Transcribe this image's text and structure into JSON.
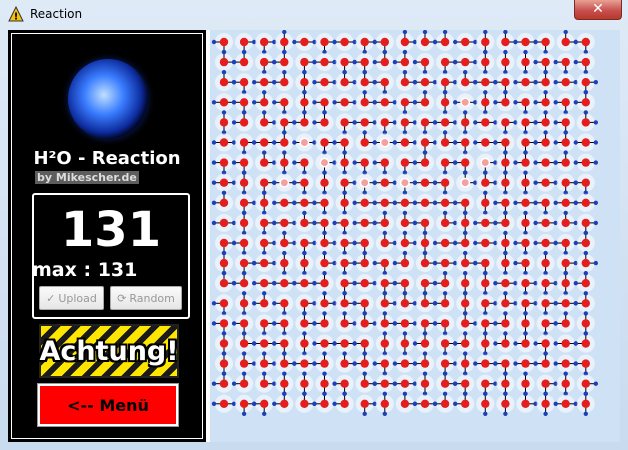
{
  "window": {
    "title": "Reaction",
    "close_label": "✕"
  },
  "panel": {
    "app_title": "H²O - Reaction",
    "byline": "by Mikescher.de",
    "score": "131",
    "max_score": "max : 131",
    "upload_label": "Upload",
    "random_label": "Random",
    "achtung_label": "Achtung!",
    "menu_label": "<-- Menü"
  },
  "colors": {
    "oxygen": "#e41e1e",
    "hydrogen": "#1e3fb8",
    "bond": "#000000",
    "board_bg": "#cfe2f5",
    "menu_red": "#ff0000"
  },
  "board": {
    "columns": 19,
    "rows": 19,
    "active_molecules": 9
  }
}
